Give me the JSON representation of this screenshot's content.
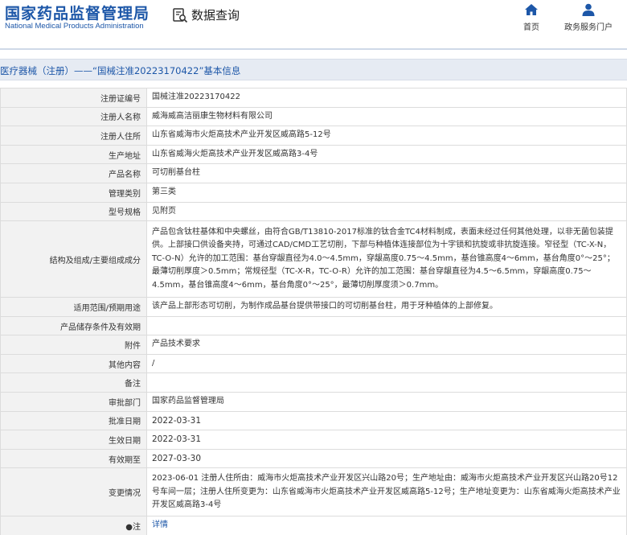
{
  "header": {
    "logo_cn": "国家药品监督管理局",
    "logo_en": "National Medical Products Administration",
    "query_title": "数据查询",
    "nav": [
      {
        "label": "首页",
        "icon": "home-icon"
      },
      {
        "label": "政务服务门户",
        "icon": "user-icon"
      }
    ]
  },
  "title": "医疗器械（注册）——“国械注准20223170422”基本信息",
  "colors": {
    "brand": "#1d57a8",
    "label_bg": "#f2f2f2",
    "title_bg": "#e6ebf3"
  },
  "rows": [
    {
      "label": "注册证编号",
      "value": "国械注准20223170422"
    },
    {
      "label": "注册人名称",
      "value": "威海威高洁丽康生物材料有限公司"
    },
    {
      "label": "注册人住所",
      "value": "山东省威海市火炬高技术产业开发区威高路5-12号"
    },
    {
      "label": "生产地址",
      "value": "山东省威海火炬高技术产业开发区威高路3-4号"
    },
    {
      "label": "产品名称",
      "value": "可切削基台柱"
    },
    {
      "label": "管理类别",
      "value": "第三类"
    },
    {
      "label": "型号规格",
      "value": "见附页"
    },
    {
      "label": "结构及组成/主要组成成分",
      "value": "产品包含钛柱基体和中央螺丝，由符合GB/T13810-2017标准的钛合金TC4材料制成，表面未经过任何其他处理，以非无菌包装提供。上部接口供设备夹持，可通过CAD/CMD工艺切削，下部与种植体连接部位为十字锁和抗旋或非抗旋连接。窄径型（TC-X-N，TC-O-N）允许的加工范围：基台穿龈直径为4.0～4.5mm，穿龈高度0.75～4.5mm，基台锥高度4～6mm，基台角度0°～25°；最薄切削厚度＞0.5mm；常规径型（TC-X-R，TC-O-R）允许的加工范围：基台穿龈直径为4.5～6.5mm，穿龈高度0.75～4.5mm，基台锥高度4～6mm，基台角度0°～25°，最薄切削厚度须＞0.7mm。"
    },
    {
      "label": "适用范围/预期用途",
      "value": "该产品上部形态可切削，为制作成品基台提供带接口的可切削基台柱，用于牙种植体的上部修复。"
    },
    {
      "label": "产品储存条件及有效期",
      "value": ""
    },
    {
      "label": "附件",
      "value": "产品技术要求"
    },
    {
      "label": "其他内容",
      "value": "/"
    },
    {
      "label": "备注",
      "value": ""
    },
    {
      "label": "审批部门",
      "value": "国家药品监督管理局"
    },
    {
      "label": "批准日期",
      "value": "2022-03-31"
    },
    {
      "label": "生效日期",
      "value": "2022-03-31"
    },
    {
      "label": "有效期至",
      "value": "2027-03-30"
    },
    {
      "label": "变更情况",
      "value": "2023-06-01 注册人住所由：威海市火炬高技术产业开发区兴山路20号；生产地址由：威海市火炬高技术产业开发区兴山路20号12号车间一层；注册人住所变更为：山东省威海市火炬高技术产业开发区威高路5-12号；生产地址变更为：山东省威海火炬高技术产业开发区威高路3-4号"
    },
    {
      "label": "●注",
      "value": "详情"
    }
  ]
}
